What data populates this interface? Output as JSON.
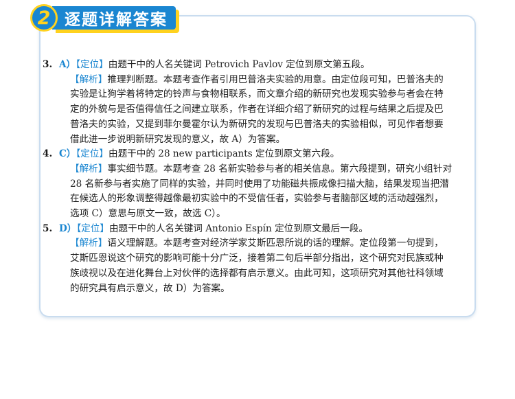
{
  "header": {
    "number": "2",
    "title": "逐题详解答案"
  },
  "items": [
    {
      "num": "3.",
      "answer": "A）",
      "locate_tag": "【定位】",
      "locate_text": "由题干中的人名关键词 Petrovich Pavlov 定位到原文第五段。",
      "explain_tag": "【解析】",
      "explain_lines": [
        "推理判断题。本题考查作者引用巴普洛夫实验的用意。由定位段可知，巴普洛夫的",
        "实验是让狗学着将特定的铃声与食物相联系，而文章介绍的新研究也发现实验参与者会在特",
        "定的外貌与是否值得信任之间建立联系，作者在详细介绍了新研究的过程与结果之后提及巴",
        "普洛夫的实验，又提到菲尔曼霍尔认为新研究的发现与巴普洛夫的实验相似，可见作者想要",
        "借此进一步说明新研究发现的意义，故 A）为答案。"
      ]
    },
    {
      "num": "4.",
      "answer": "C）",
      "locate_tag": "【定位】",
      "locate_text": "由题干中的 28 new participants 定位到原文第六段。",
      "explain_tag": "【解析】",
      "explain_lines": [
        "事实细节题。本题考查 28 名新实验参与者的相关信息。第六段提到，研究小组针对",
        "28 名新参与者实施了同样的实验，并同时使用了功能磁共振成像扫描大脑，结果发现当把潜",
        "在候选人的形象调整得越像最初实验中的不受信任者，实验参与者脑部区域的活动越强烈，",
        "选项 C）意思与原文一致，故选 C）。"
      ]
    },
    {
      "num": "5.",
      "answer": "D）",
      "locate_tag": "【定位】",
      "locate_text": "由题干中的人名关键词 Antonio Espín 定位到原文最后一段。",
      "explain_tag": "【解析】",
      "explain_lines": [
        "语义理解题。本题考查对经济学家艾斯匹恩所说的话的理解。定位段第一句提到，",
        "艾斯匹恩说这个研究的影响可能十分广泛，接着第二句后半部分指出，这个研究对民族或种",
        "族歧视以及在进化舞台上对伙伴的选择都有启示意义。由此可知，这项研究对其他社科领域",
        "的研究具有启示意义，故 D）为答案。"
      ]
    }
  ]
}
